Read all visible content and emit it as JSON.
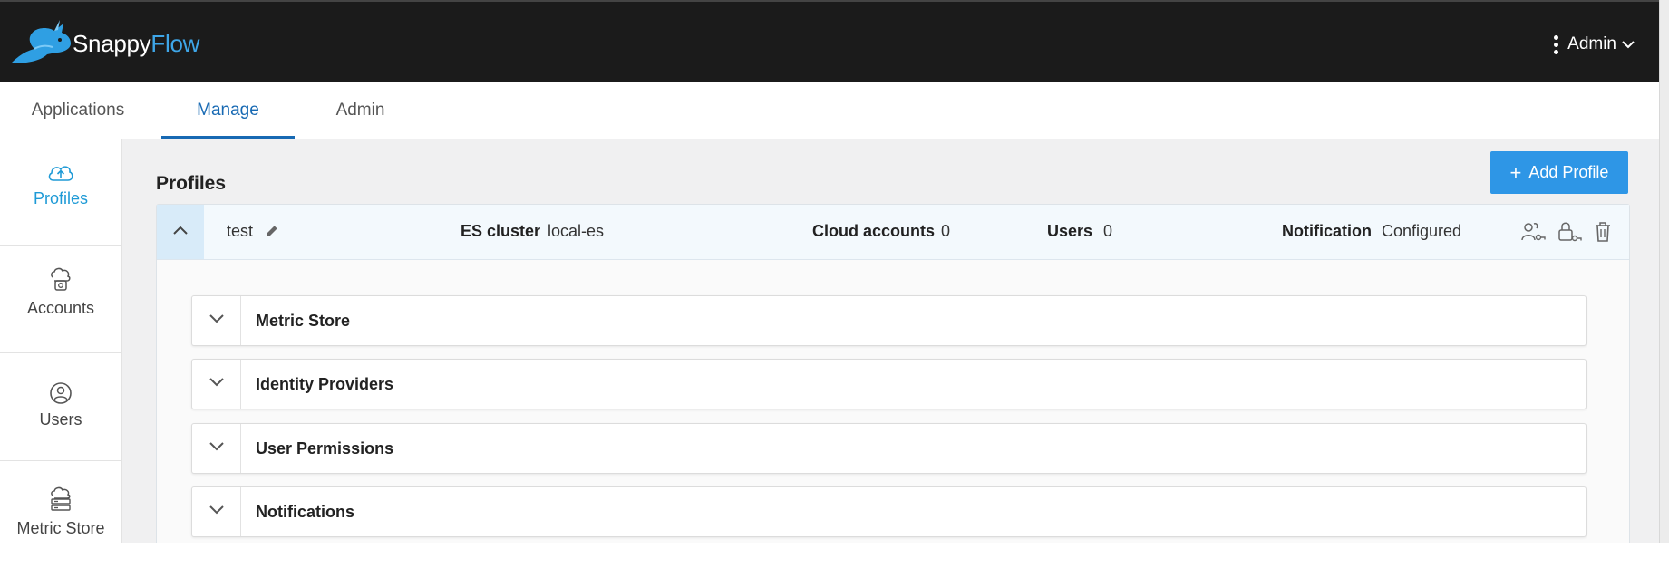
{
  "header": {
    "logo": {
      "part1": "Snappy",
      "part2": "Flow",
      "icon": "rabbit-logo-icon"
    },
    "user_menu": {
      "label": "Admin",
      "icon": "kebab-icon",
      "chevron": "chevron-down-icon"
    }
  },
  "tabs": [
    {
      "label": "Applications",
      "active": false
    },
    {
      "label": "Manage",
      "active": true
    },
    {
      "label": "Admin",
      "active": false
    }
  ],
  "sidebar": {
    "items": [
      {
        "label": "Profiles",
        "icon": "cloud-upload-icon",
        "active": true
      },
      {
        "label": "Accounts",
        "icon": "accounts-icon",
        "active": false
      },
      {
        "label": "Users",
        "icon": "user-circle-icon",
        "active": false
      },
      {
        "label": "Metric Store",
        "icon": "metric-store-icon",
        "active": false
      }
    ]
  },
  "main": {
    "title": "Profiles",
    "add_button": "Add Profile",
    "profile": {
      "name": "test",
      "es_cluster_label": "ES cluster",
      "es_cluster_value": "local-es",
      "cloud_accounts_label": "Cloud accounts",
      "cloud_accounts_value": "0",
      "users_label": "Users",
      "users_value": "0",
      "notification_label": "Notification",
      "notification_value": "Configured",
      "sections": [
        "Metric Store",
        "Identity Providers",
        "User Permissions",
        "Notifications"
      ]
    }
  },
  "colors": {
    "accent": "#1769b3",
    "sidebar_active": "#1e9ad6",
    "button": "#2e96e6",
    "topbar": "#1b1b1b"
  }
}
